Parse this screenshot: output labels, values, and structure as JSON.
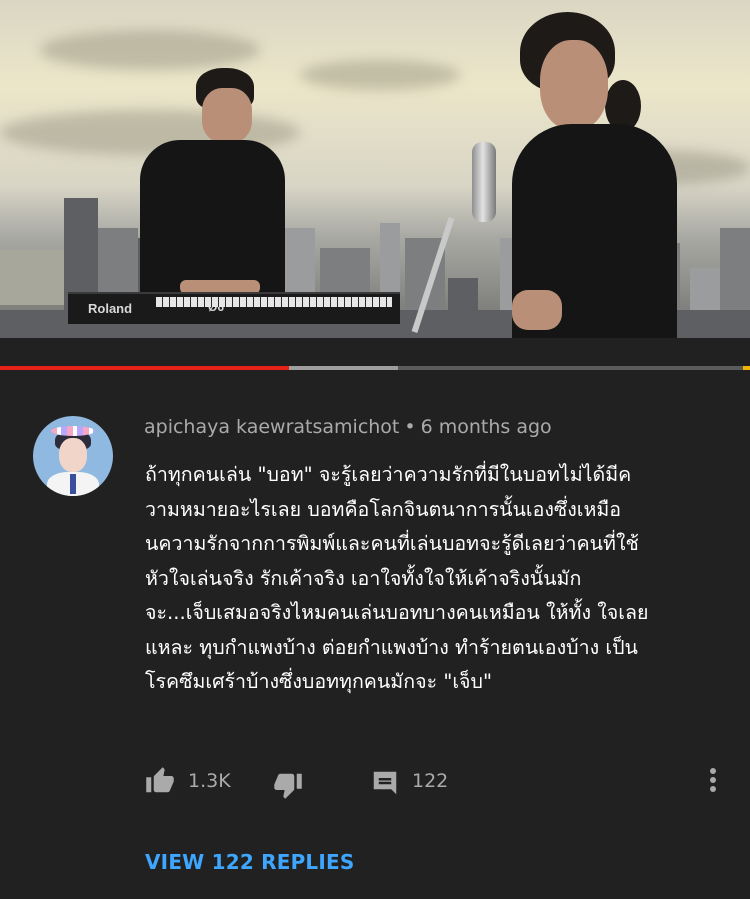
{
  "video": {
    "keyboard_brand": "Roland",
    "keyboard_model": "Ø6"
  },
  "player": {
    "played_fraction": 0.385,
    "buffered_fraction": 0.53,
    "colors": {
      "played": "#e62117",
      "buffered": "#9e9e9e",
      "track": "#5c5c5c",
      "marker": "#f2b400"
    }
  },
  "comment": {
    "author": "apichaya kaewratsamichot",
    "separator": "•",
    "time": "6 months ago",
    "lines": [
      "ถ้าทุกคนเล่น \"บอท\" จะรู้เลยว่าความรักที่มีในบอทไม่ได้มีค",
      "วามหมายอะไรเลย บอทคือโลกจินตนาการนั้นเองซึ่งเหมือ",
      "นความรักจากการพิมพ์และคนที่เล่นบอทจะรู้ดีเลยว่าคนที่ใช้",
      "หัวใจเล่นจริง รักเค้าจริง เอาใจทั้งใจให้เค้าจริงนั้นมัก",
      "จะ...เจ็บเสมอจริงไหมคนเล่นบอทบางคนเหมือน ให้ทั้ง ใจเลย",
      "แหละ ทุบกำแพงบ้าง ต่อยกำแพงบ้าง ทำร้ายตนเองบ้าง เป็น",
      "โรคซึมเศร้าบ้างซึ่งบอททุกคนมักจะ \"เจ็บ\""
    ],
    "like_count": "1.3K",
    "reply_count": "122",
    "view_replies_label": "VIEW 122 REPLIES",
    "icons": {
      "like": "thumbs-up-icon",
      "dislike": "thumbs-down-icon",
      "reply": "comment-icon",
      "menu": "more-vertical-icon"
    }
  }
}
